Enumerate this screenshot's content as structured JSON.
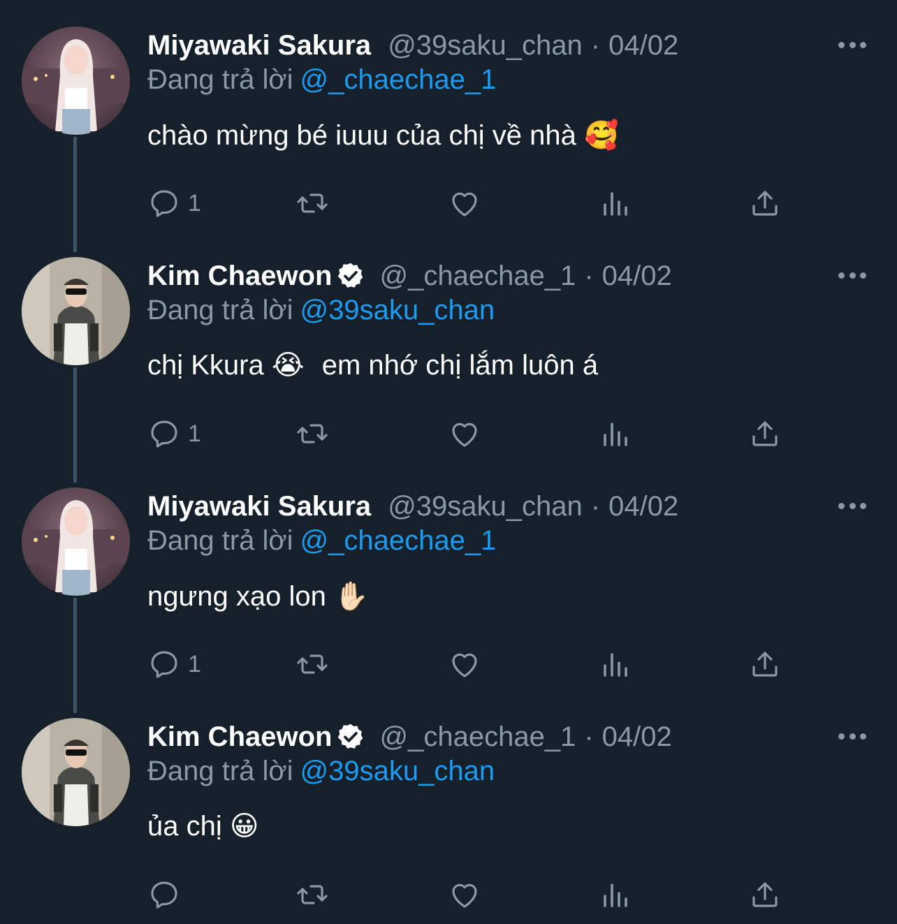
{
  "tweets": [
    {
      "name": "Miyawaki Sakura",
      "handle": "@39saku_chan",
      "separator": "·",
      "date": "04/02",
      "replying_prefix": "Đang trả lời",
      "replying_to": "@_chaechae_1",
      "text": "chào mừng bé iuuu của chị về nhà",
      "emoji": "🥰",
      "reply_count": "1",
      "verified": false
    },
    {
      "name": "Kim Chaewon",
      "handle": "@_chaechae_1",
      "separator": "·",
      "date": "04/02",
      "replying_prefix": "Đang trả lời",
      "replying_to": "@39saku_chan",
      "text": "chị Kkura",
      "emoji": "😭",
      "text_after": "em nhớ chị lắm luôn á",
      "reply_count": "1",
      "verified": true
    },
    {
      "name": "Miyawaki Sakura",
      "handle": "@39saku_chan",
      "separator": "·",
      "date": "04/02",
      "replying_prefix": "Đang trả lời",
      "replying_to": "@_chaechae_1",
      "text": "ngưng xạo lon",
      "emoji": "✋🏻",
      "reply_count": "1",
      "verified": false
    },
    {
      "name": "Kim Chaewon",
      "handle": "@_chaechae_1",
      "separator": "·",
      "date": "04/02",
      "replying_prefix": "Đang trả lời",
      "replying_to": "@39saku_chan",
      "text": "ủa chị",
      "emoji": "😀",
      "reply_count": "",
      "verified": true
    }
  ],
  "colors": {
    "background": "#15202b",
    "secondary_text": "#8b98a5",
    "link": "#1d9bf0",
    "thread_line": "#3d5466"
  },
  "icons": [
    "reply-icon",
    "retweet-icon",
    "like-icon",
    "analytics-icon",
    "share-icon",
    "more-icon",
    "verified-badge-icon"
  ]
}
